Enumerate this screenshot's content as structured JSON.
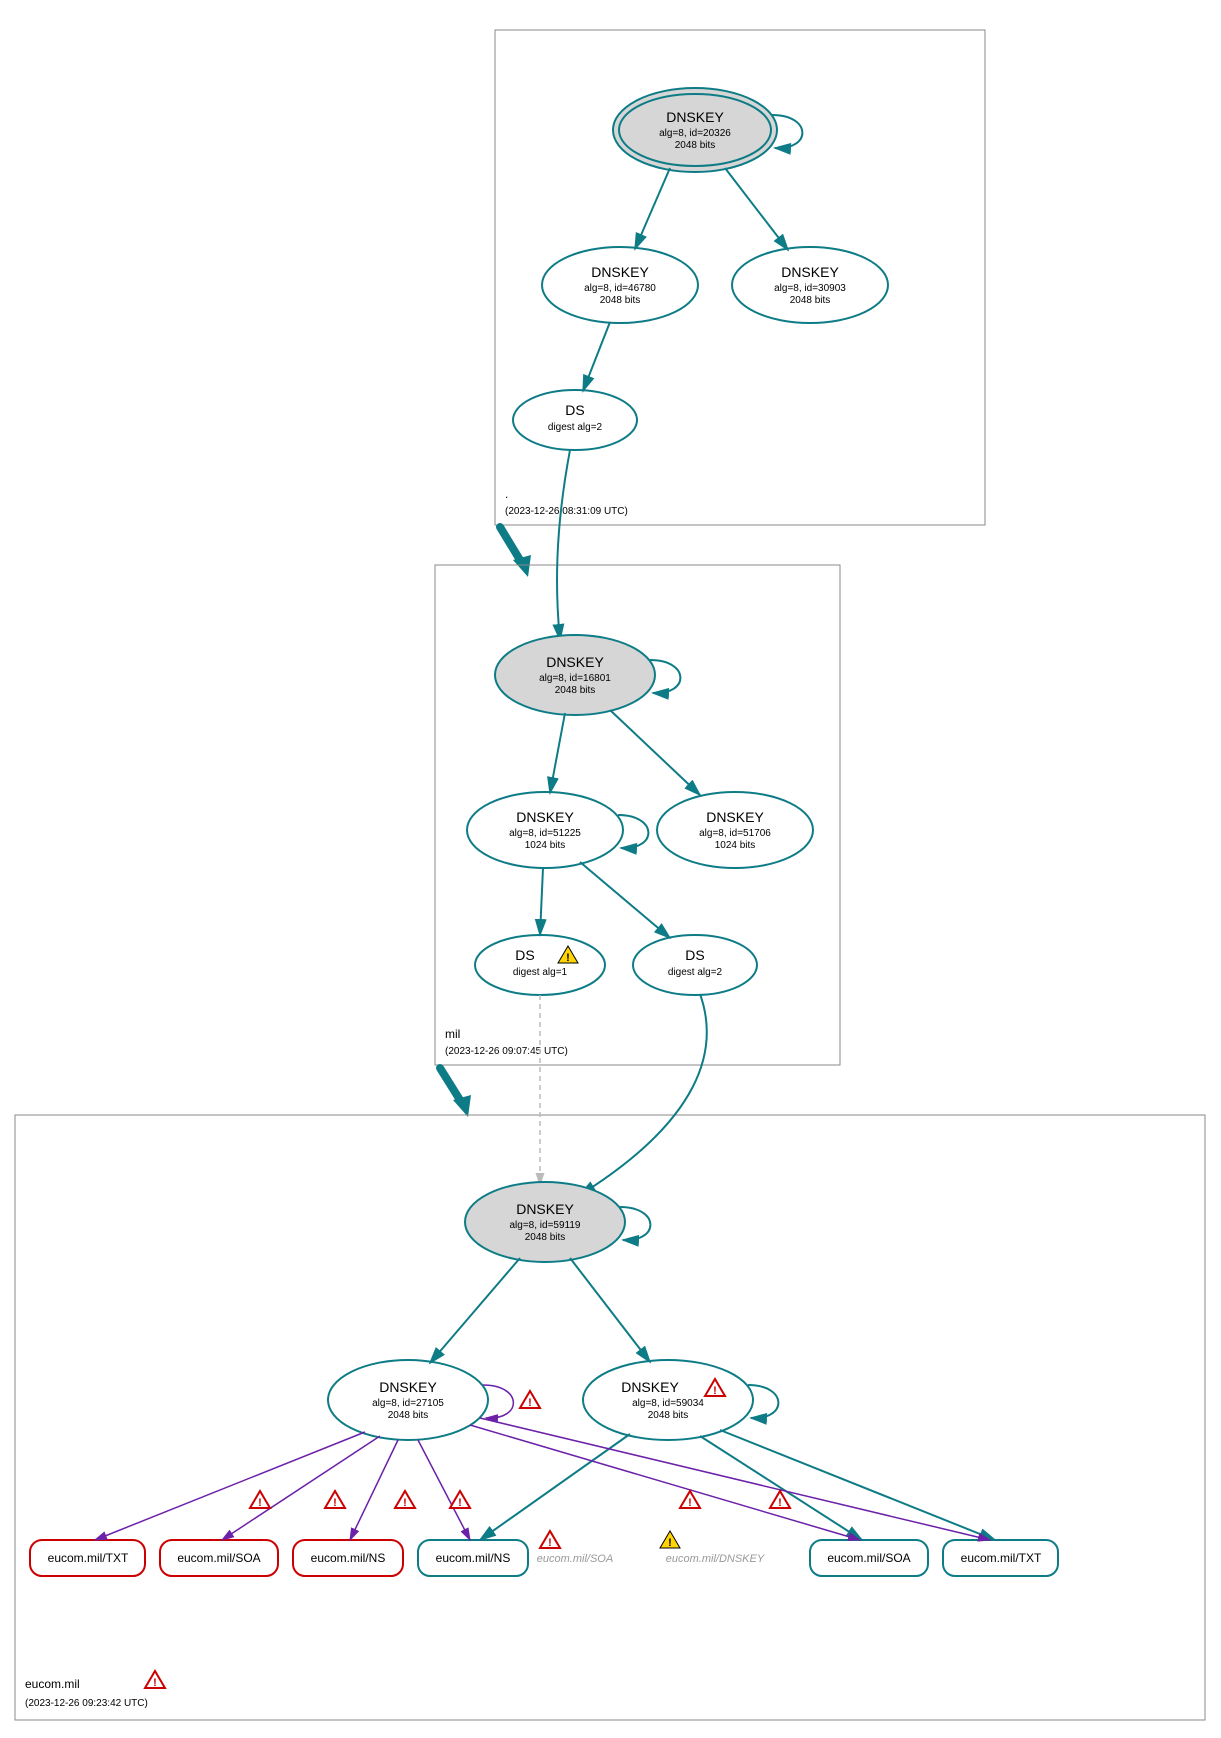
{
  "colors": {
    "teal": "#0E7C86",
    "red": "#CC0000",
    "purple": "#6B21A8",
    "gray_fill": "#d6d6d6"
  },
  "zones": {
    "root": {
      "label": ".",
      "timestamp": "(2023-12-26 08:31:09 UTC)"
    },
    "mil": {
      "label": "mil",
      "timestamp": "(2023-12-26 09:07:45 UTC)"
    },
    "eucom": {
      "label": "eucom.mil",
      "timestamp": "(2023-12-26 09:23:42 UTC)",
      "has_error": true
    }
  },
  "nodes": {
    "root_ksk": {
      "title": "DNSKEY",
      "line1": "alg=8, id=20326",
      "line2": "2048 bits",
      "filled": true,
      "double_ring": true
    },
    "root_zsk1": {
      "title": "DNSKEY",
      "line1": "alg=8, id=46780",
      "line2": "2048 bits"
    },
    "root_zsk2": {
      "title": "DNSKEY",
      "line1": "alg=8, id=30903",
      "line2": "2048 bits"
    },
    "root_ds": {
      "title": "DS",
      "line1": "digest alg=2"
    },
    "mil_ksk": {
      "title": "DNSKEY",
      "line1": "alg=8, id=16801",
      "line2": "2048 bits",
      "filled": true
    },
    "mil_zsk1": {
      "title": "DNSKEY",
      "line1": "alg=8, id=51225",
      "line2": "1024 bits"
    },
    "mil_zsk2": {
      "title": "DNSKEY",
      "line1": "alg=8, id=51706",
      "line2": "1024 bits"
    },
    "mil_ds1": {
      "title": "DS",
      "line1": "digest alg=1",
      "warning": true
    },
    "mil_ds2": {
      "title": "DS",
      "line1": "digest alg=2"
    },
    "eucom_ksk": {
      "title": "DNSKEY",
      "line1": "alg=8, id=59119",
      "line2": "2048 bits",
      "filled": true
    },
    "eucom_zsk1": {
      "title": "DNSKEY",
      "line1": "alg=8, id=27105",
      "line2": "2048 bits"
    },
    "eucom_zsk2": {
      "title": "DNSKEY",
      "line1": "alg=8, id=59034",
      "line2": "2048 bits",
      "error": true
    }
  },
  "records": {
    "r1": {
      "label": "eucom.mil/TXT",
      "error": true
    },
    "r2": {
      "label": "eucom.mil/SOA",
      "error": true
    },
    "r3": {
      "label": "eucom.mil/NS",
      "error": true
    },
    "r4": {
      "label": "eucom.mil/NS"
    },
    "r5": {
      "label": "eucom.mil/SOA",
      "ghost": true,
      "error": true
    },
    "r6": {
      "label": "eucom.mil/DNSKEY",
      "ghost": true,
      "warning": true
    },
    "r7": {
      "label": "eucom.mil/SOA"
    },
    "r8": {
      "label": "eucom.mil/TXT"
    }
  },
  "edges_with_error": [
    "e1",
    "e2",
    "e3",
    "e4",
    "e5",
    "e6",
    "e7"
  ]
}
